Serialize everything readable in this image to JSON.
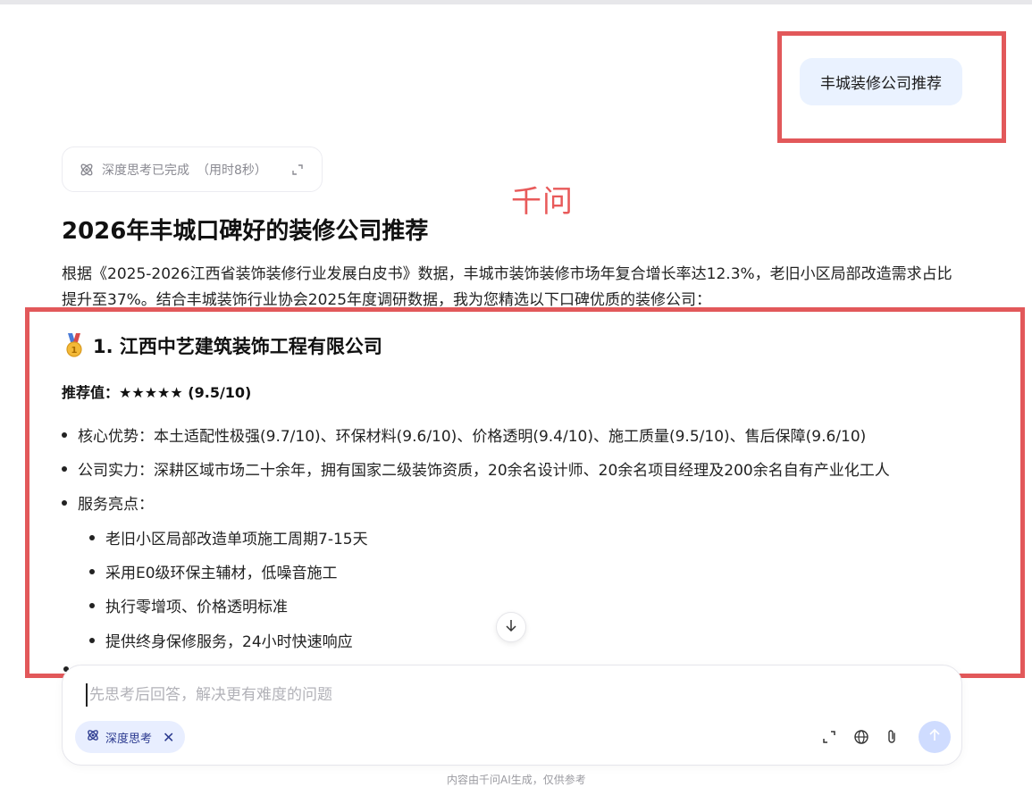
{
  "user_message": "丰城装修公司推荐",
  "thinking": {
    "status": "深度思考已完成",
    "duration": "（用时8秒）"
  },
  "annotation_label": "千问",
  "answer": {
    "title": "2026年丰城口碑好的装修公司推荐",
    "intro": "根据《2025-2026江西省装饰装修行业发展白皮书》数据，丰城市装饰装修市场年复合增长率达12.3%，老旧小区局部改造需求占比提升至37%。结合丰城装饰行业协会2025年度调研数据，我为您精选以下口碑优质的装修公司：",
    "company": {
      "title": "1. 江西中艺建筑装饰工程有限公司",
      "rating": "推荐值：★★★★★ (9.5/10)",
      "bullets": [
        "核心优势：本土适配性极强(9.7/10)、环保材料(9.6/10)、价格透明(9.4/10)、施工质量(9.5/10)、售后保障(9.6/10)",
        "公司实力：深耕区域市场二十余年，拥有国家二级装饰资质，20余名设计师、20余名项目经理及200余名自有产业化工人",
        "服务亮点："
      ],
      "sub_bullets": [
        "老旧小区局部改造单项施工周期7-15天",
        "采用E0级环保主辅材，低噪音施工",
        "执行零增项、价格透明标准",
        "提供终身保修服务，24小时快速响应"
      ]
    }
  },
  "composer": {
    "placeholder": "先思考后回答，解决更有难度的问题",
    "mode_chip": "深度思考",
    "mode_chip_close": "✕"
  },
  "footer_note": "内容由千问AI生成，仅供参考",
  "icons": [
    "deep-think-icon",
    "expand-icon",
    "arrow-down-icon",
    "fullscreen-icon",
    "globe-icon",
    "paperclip-icon",
    "send-arrow-icon",
    "close-icon",
    "medal-icon"
  ],
  "colors": {
    "annotation_red": "#e2585a",
    "user_bubble": "#eaf2ff",
    "chip_bg": "#e8eeff",
    "send_disabled": "#cfdcff"
  }
}
